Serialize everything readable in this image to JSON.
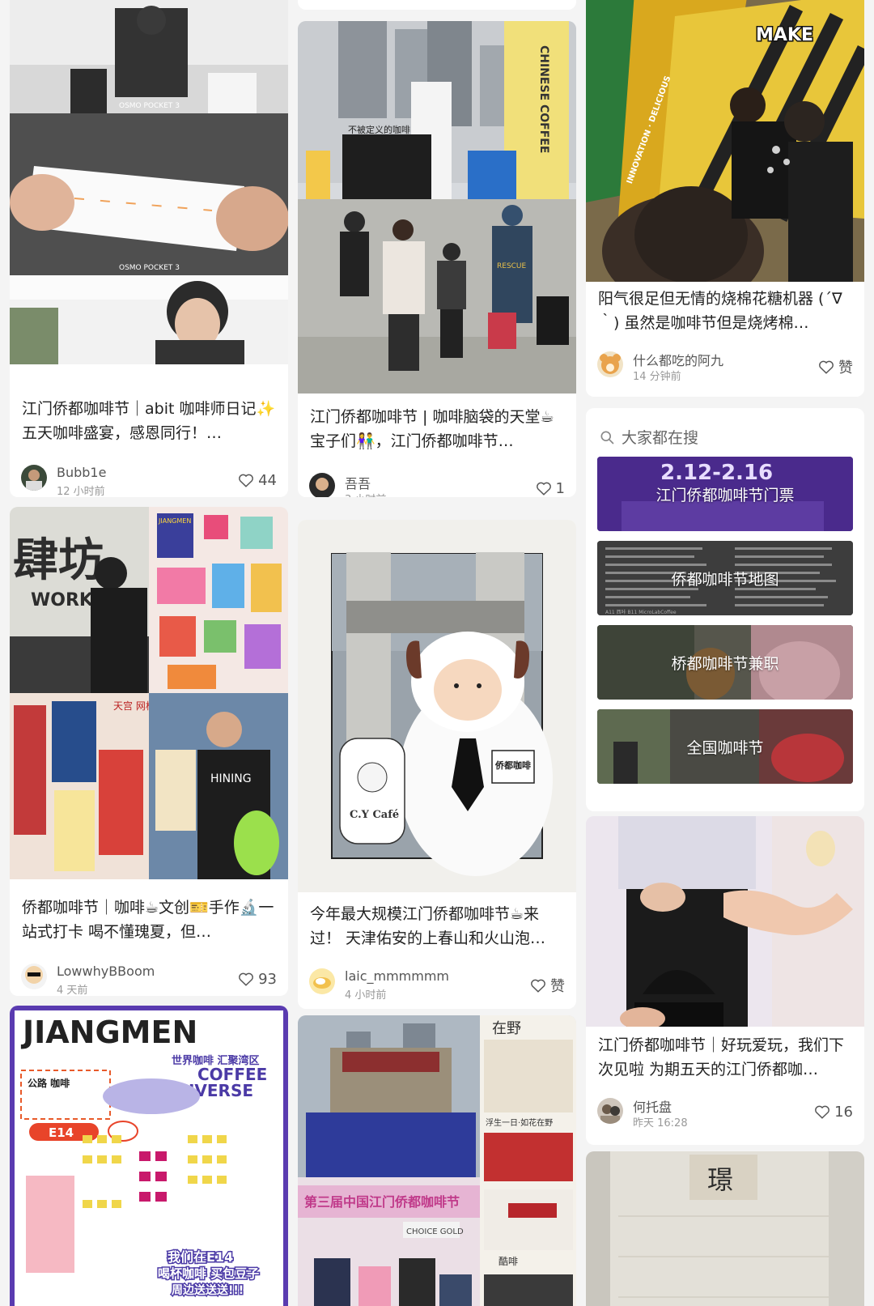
{
  "feed": {
    "col1": [
      {
        "title": "江门侨都咖啡节｜abit 咖啡师日记✨ 五天咖啡盛宴，感恩同行！…",
        "author": "Bubb1e",
        "time": "12 小时前",
        "likes": "44",
        "cover_caption": "OSMO POCKET 3"
      },
      {
        "title": "侨都咖啡节｜咖啡☕文创🎫手作🔬一站式打卡 喝不懂瑰夏，但…",
        "author": "LowwhyBBoom",
        "time": "4 天前",
        "likes": "93",
        "cover_text": [
          "肆坊",
          "WORKSH",
          "天宫 网格片",
          "HINING",
          "JIANGMEN"
        ]
      },
      {
        "title": "",
        "cover_text": [
          "JIANGMEN",
          "世界咖啡 汇聚湾区",
          "COFFEE",
          "UNIVERSE",
          "公路 咖啡",
          "E14",
          "我们在E14",
          "喝杯咖啡 买包豆子",
          "周边送送送!!!"
        ]
      }
    ],
    "col2": [
      {
        "title": "江门侨都咖啡节 | 咖啡脑袋的天堂☕ 宝子们👫，江门侨都咖啡节…",
        "author": "吾吾",
        "time": "3 小时前",
        "likes": "1",
        "cover_text": [
          "不被定义的咖啡",
          "CHINESE COFFEE",
          "RESCUE"
        ]
      },
      {
        "title": "今年最大规模江门侨都咖啡节☕来过！ 天津佑安的上春山和火山泡…",
        "author": "laic_mmmmmm",
        "time": "4 小时前",
        "likes": "赞",
        "cover_text": [
          "C.Y Café",
          "侨都咖啡"
        ]
      },
      {
        "title": "",
        "cover_text": [
          "第三届中国江门侨都咖啡节",
          "在野",
          "浮生一日·如花在野",
          "CHOICE GOLD",
          "酷啡"
        ]
      }
    ],
    "col3": [
      {
        "title": "阳气很足但无情的烧棉花糖机器 (´∇｀) 虽然是咖啡节但是烧烤棉…",
        "author": "什么都吃的阿九",
        "time": "14 分钟前",
        "likes": "赞",
        "cover_text": [
          "MAKE",
          "INNOVATION · DELICIOUS"
        ]
      },
      {
        "title": "江门侨都咖啡节｜好玩爱玩，我们下次见啦 为期五天的江门侨都咖…",
        "author": "何托盘",
        "time": "昨天 16:28",
        "likes": "16"
      },
      {
        "title": "",
        "cover_text": [
          "璟"
        ]
      }
    ]
  },
  "search": {
    "heading": "大家都在搜",
    "items": [
      {
        "label": "江门侨都咖啡节门票",
        "bg_text": "2.12-2.16"
      },
      {
        "label": "侨都咖啡节地图",
        "bg_text": "A11 西咔  B11 MicroLabCoffee"
      },
      {
        "label": "桥都咖啡节兼职"
      },
      {
        "label": "全国咖啡节"
      }
    ]
  },
  "colors": {
    "background": "#f4f4f4",
    "card": "#ffffff",
    "tile1": "#4a2a8c"
  }
}
